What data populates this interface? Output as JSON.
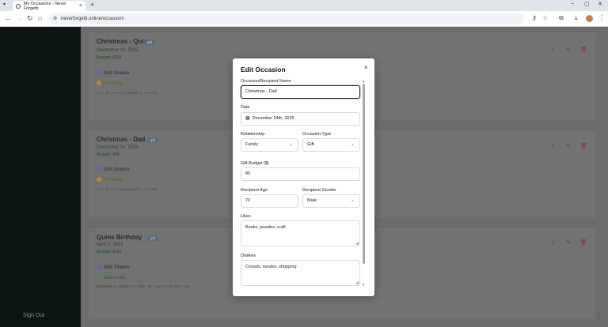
{
  "browser": {
    "tab_title": "My Occasions - Never Forgetti",
    "url": "neverforgetti.online/occasions"
  },
  "sidebar": {
    "sign_out": "Sign Out"
  },
  "cards": [
    {
      "title": "Christmas - Quin",
      "badge": "gift",
      "date": "December 24, 2025",
      "budget": "Budget: $250",
      "gift_status_label": "Gift Status",
      "status": "Pending",
      "note": "Your gift is being prepared by our team."
    },
    {
      "title": "Christmas - Dad",
      "badge": "gift",
      "date": "December 24, 2025",
      "budget": "Budget: $80",
      "gift_status_label": "Gift Status",
      "status": "Pending",
      "note": "Your gift is being prepared by our team."
    },
    {
      "title": "Quins Birthday",
      "badge": "gift",
      "date": "April 9, 2026",
      "budget": "Budget: $100",
      "gift_status_label": "Gift Status",
      "status": "Delivered",
      "note": "Delivered on October 24, 2025. We hope it made their day!"
    }
  ],
  "modal": {
    "title": "Edit Occasion",
    "close": "×",
    "name_label": "Occasion/Recipient Name",
    "name_value": "Christmas - Dad",
    "date_label": "Date",
    "date_value": "December 24th, 2025",
    "relationship_label": "Relationship",
    "relationship_value": "Family",
    "occasion_type_label": "Occasion Type",
    "occasion_type_value": "Gift",
    "budget_label": "Gift Budget ($)",
    "budget_value": "80",
    "age_label": "Recipient Age",
    "age_value": "70",
    "gender_label": "Recipient Gender",
    "gender_value": "Male",
    "likes_label": "Likes",
    "likes_value": "Books, puzzles, craft",
    "dislikes_label": "Dislikes",
    "dislikes_value": "Crowds, movies, shopping"
  },
  "icons": [
    "tab-menu-icon",
    "favicon-icon",
    "close-tab-icon",
    "new-tab-icon",
    "back-icon",
    "forward-icon",
    "reload-icon",
    "home-icon",
    "site-settings-icon",
    "password-key-icon",
    "star-icon",
    "extensions-icon",
    "download-icon",
    "profile-avatar",
    "kebab-menu-icon",
    "calendar-icon",
    "chevron-down-icon",
    "download-card-icon",
    "edit-icon",
    "trash-icon"
  ]
}
